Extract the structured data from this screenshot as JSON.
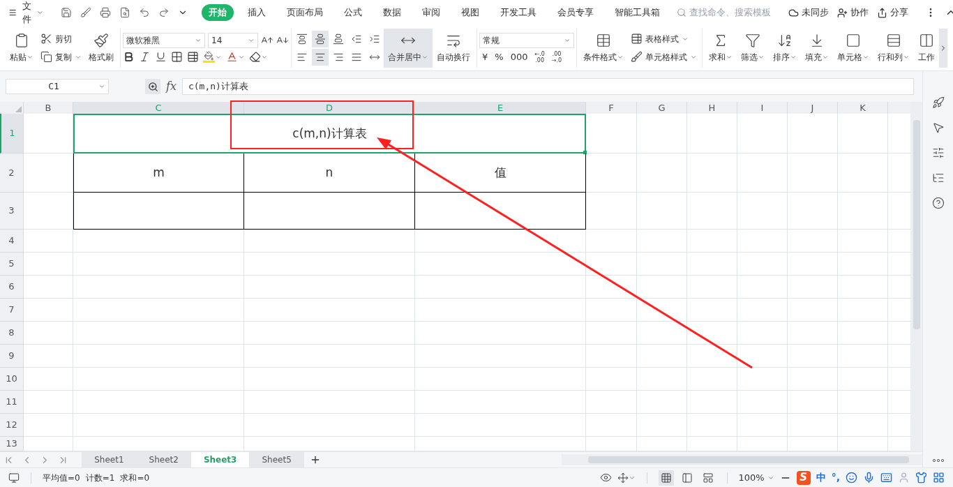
{
  "menu": {
    "file": "文件",
    "tabs": [
      {
        "label": "开始",
        "selected": true
      },
      {
        "label": "插入",
        "selected": false
      },
      {
        "label": "页面布局",
        "selected": false
      },
      {
        "label": "公式",
        "selected": false
      },
      {
        "label": "数据",
        "selected": false
      },
      {
        "label": "审阅",
        "selected": false
      },
      {
        "label": "视图",
        "selected": false
      },
      {
        "label": "开发工具",
        "selected": false
      },
      {
        "label": "会员专享",
        "selected": false
      },
      {
        "label": "智能工具箱",
        "selected": false
      }
    ],
    "search": {
      "placeholder": "查找命令、搜索模板"
    },
    "actions": [
      "未同步",
      "协作",
      "分享"
    ]
  },
  "ribbon": {
    "clipboard": [
      "粘贴",
      "剪切",
      "复制",
      "格式刷"
    ],
    "font": {
      "family": "微软雅黑",
      "size": "14"
    },
    "alignment": [
      {
        "selected": false
      },
      {
        "selected": true
      },
      {
        "selected": false
      },
      {
        "selected": false
      },
      {
        "selected": false
      },
      {
        "selected": false
      },
      {
        "selected": true
      },
      {
        "selected": false
      },
      {
        "selected": false
      },
      {
        "selected": false
      }
    ],
    "merge": {
      "label": "合并居中",
      "selected": true
    },
    "wrap": {
      "label": "自动换行",
      "selected": false
    },
    "number": {
      "format": "常规",
      "buttons": [
        {
          "kind": "symbol",
          "text": "¥"
        },
        {
          "kind": "symbol",
          "text": "%"
        },
        {
          "kind": "symbol",
          "text": "000"
        },
        {
          "kind": "decimal",
          "top": "←.0",
          "bottom": ".00"
        },
        {
          "kind": "decimal",
          "top": ".00",
          "bottom": "→.0"
        }
      ]
    },
    "styles": [
      "条件格式",
      "表格样式",
      "单元格样式"
    ],
    "editing": [
      "求和",
      "筛选",
      "排序",
      "填充",
      "单元格",
      "行和列",
      "工作"
    ]
  },
  "formula": {
    "name_box": "C1",
    "fx": "fx",
    "value": "c(m,n)计算表"
  },
  "grid": {
    "columns": [
      {
        "label": "B",
        "selected": false
      },
      {
        "label": "C",
        "selected": true
      },
      {
        "label": "D",
        "selected": true
      },
      {
        "label": "E",
        "selected": true
      },
      {
        "label": "F",
        "selected": false
      },
      {
        "label": "G",
        "selected": false
      },
      {
        "label": "H",
        "selected": false
      },
      {
        "label": "I",
        "selected": false
      },
      {
        "label": "J",
        "selected": false
      },
      {
        "label": "K",
        "selected": false
      }
    ],
    "rows": [
      {
        "label": "1",
        "selected": true
      },
      {
        "label": "2",
        "selected": false
      },
      {
        "label": "3",
        "selected": false
      },
      {
        "label": "4",
        "selected": false
      },
      {
        "label": "5",
        "selected": false
      },
      {
        "label": "6",
        "selected": false
      },
      {
        "label": "7",
        "selected": false
      },
      {
        "label": "8",
        "selected": false
      },
      {
        "label": "9",
        "selected": false
      },
      {
        "label": "10",
        "selected": false
      },
      {
        "label": "11",
        "selected": false
      },
      {
        "label": "12",
        "selected": false
      },
      {
        "label": "13",
        "selected": false
      }
    ],
    "title": "c(m,n)计算表",
    "headers": [
      "m",
      "n",
      "值"
    ]
  },
  "sheets": [
    {
      "label": "Sheet1",
      "selected": false
    },
    {
      "label": "Sheet2",
      "selected": false
    },
    {
      "label": "Sheet3",
      "selected": true
    },
    {
      "label": "Sheet5",
      "selected": false
    }
  ],
  "status": {
    "stats": [
      "平均值=0",
      "计数=1",
      "求和=0"
    ],
    "zoom": "100%",
    "views": [
      {
        "selected": true
      },
      {
        "selected": false
      },
      {
        "selected": false
      }
    ],
    "ime": {
      "logo": "S",
      "items": [
        "中",
        "°,"
      ]
    }
  }
}
